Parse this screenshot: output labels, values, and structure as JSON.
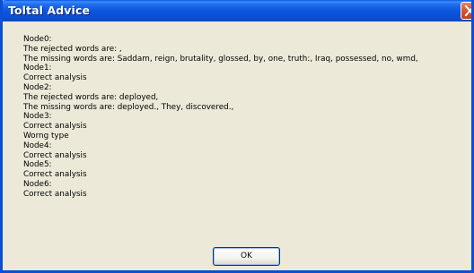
{
  "window": {
    "title": "Toltal Advice"
  },
  "message": {
    "lines": [
      "Node0:",
      "The rejected words are: ,",
      "The missing words are: Saddam, reign, brutality, glossed, by, one, truth:, Iraq, possessed, no, wmd,",
      "Node1:",
      "Correct analysis",
      "Node2:",
      "The rejected words are: deployed,",
      "The missing words are: deployed., They, discovered.,",
      "Node3:",
      "Correct analysis",
      "Worng type",
      "Node4:",
      "Correct analysis",
      "Node5:",
      "Correct analysis",
      "Node6:",
      "Correct analysis"
    ]
  },
  "buttons": {
    "ok_label": "OK"
  },
  "icons": {
    "close": "close-icon"
  },
  "colors": {
    "titlebar": "#0a4fd4",
    "close_button": "#d65b35",
    "background": "#ece9d8"
  }
}
